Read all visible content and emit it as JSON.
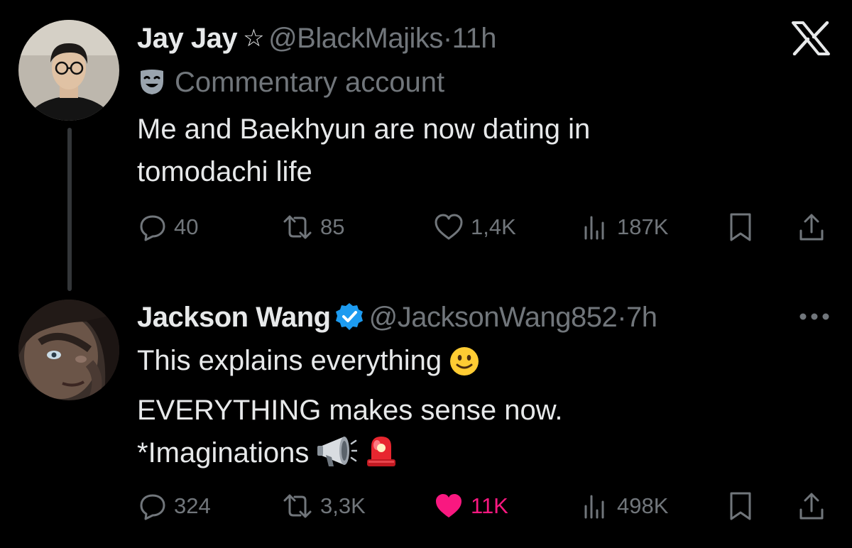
{
  "tweet1": {
    "name": "Jay Jay",
    "badge_icon": "star-outline-icon",
    "handle": "@BlackMajiks",
    "separator": "·",
    "time": "11h",
    "label_icon": "theater-mask-icon",
    "label": "Commentary account",
    "text_lines": [
      "Me and Baekhyun are now dating in",
      "tomodachi life"
    ],
    "replies": "40",
    "reposts": "85",
    "likes": "1,4K",
    "views": "187K"
  },
  "tweet2": {
    "name": "Jackson Wang",
    "badge_icon": "verified-badge-icon",
    "handle": "@JacksonWang852",
    "separator": "·",
    "time": "7h",
    "text_lines": [
      "This explains everything",
      "EVERYTHING makes sense now.",
      "*Imaginations"
    ],
    "replies": "324",
    "reposts": "3,3K",
    "likes": "11K",
    "views": "498K",
    "liked": true
  },
  "colors": {
    "background": "#000000",
    "text": "#e7e9ea",
    "secondary": "#71767b",
    "like": "#f91880",
    "verified": "#1d9bf0"
  }
}
